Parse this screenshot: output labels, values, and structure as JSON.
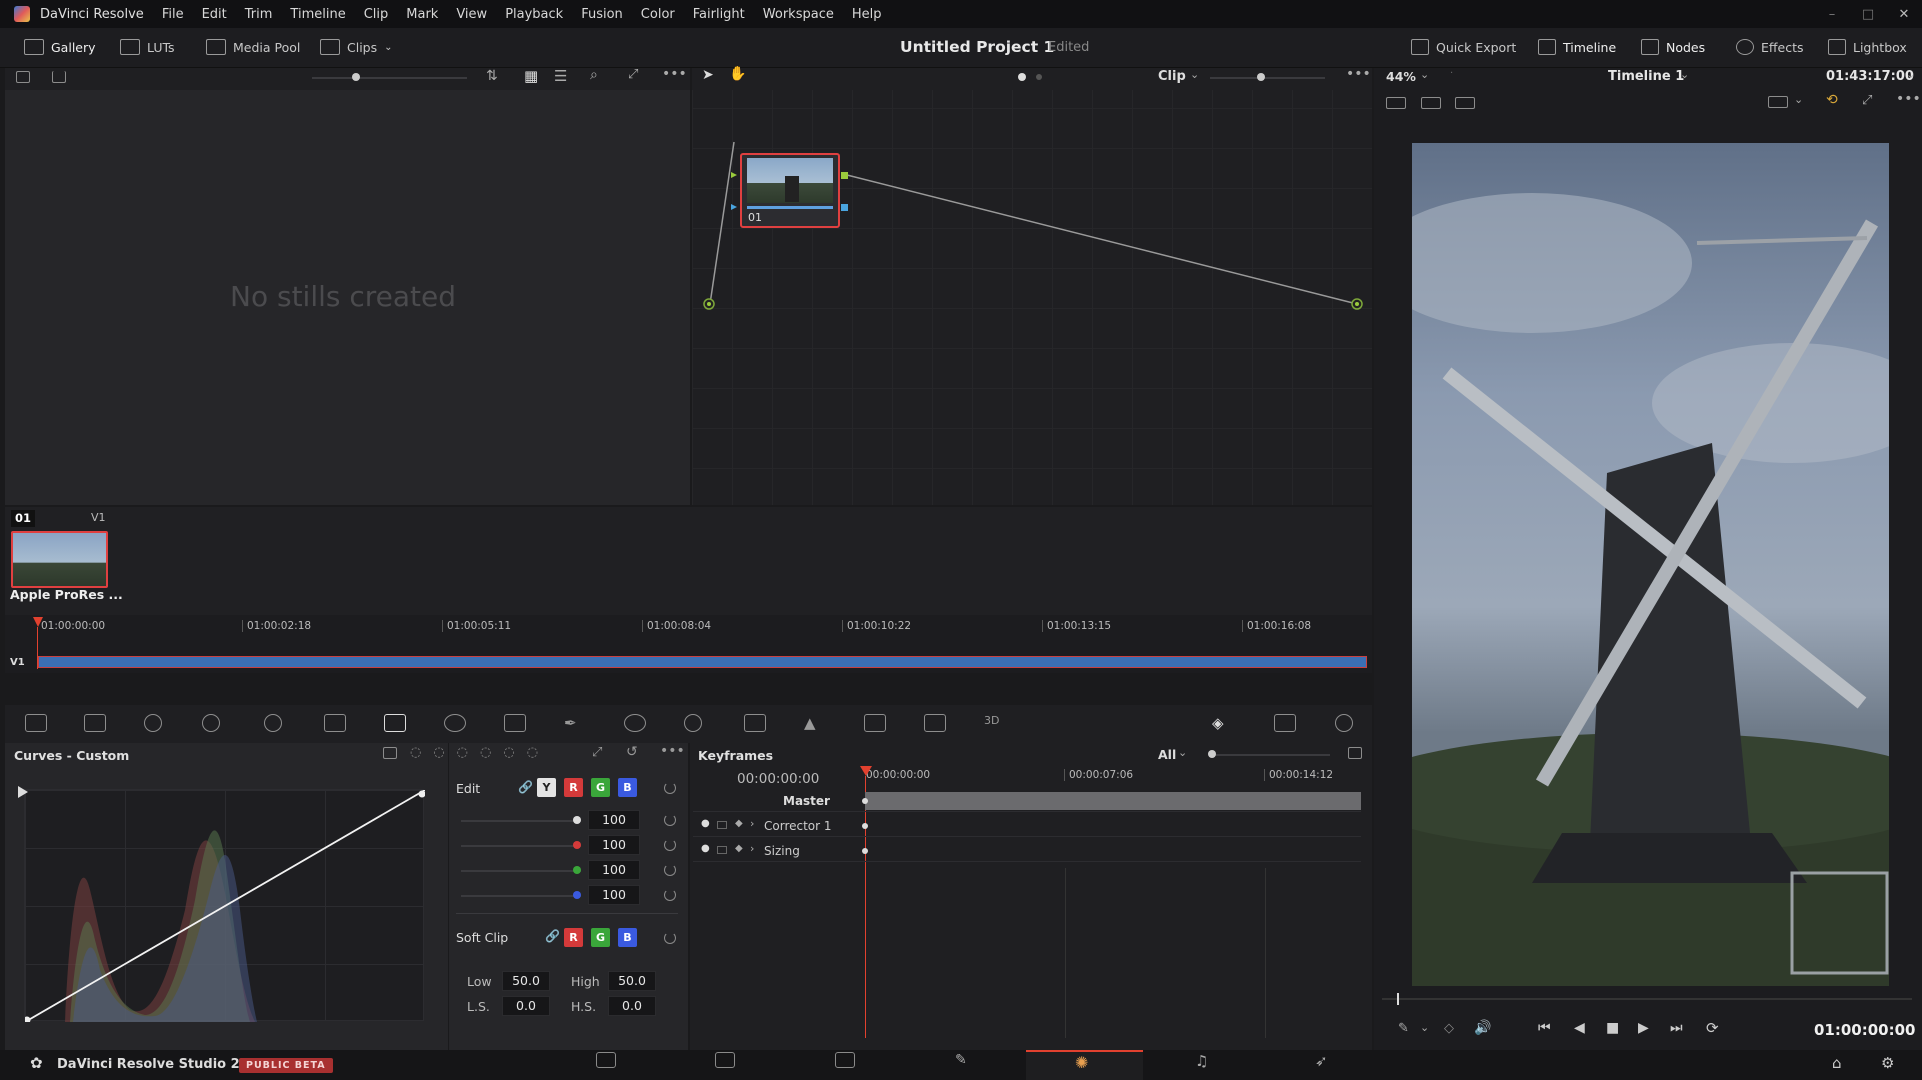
{
  "menubar": {
    "app": "DaVinci Resolve",
    "items": [
      "File",
      "Edit",
      "Trim",
      "Timeline",
      "Clip",
      "Mark",
      "View",
      "Playback",
      "Fusion",
      "Color",
      "Fairlight",
      "Workspace",
      "Help"
    ]
  },
  "toolbar": {
    "gallery": "Gallery",
    "luts": "LUTs",
    "media_pool": "Media Pool",
    "clips": "Clips",
    "project": "Untitled Project 1",
    "status": "Edited",
    "quick_export": "Quick Export",
    "timeline": "Timeline",
    "nodes": "Nodes",
    "effects": "Effects",
    "lightbox": "Lightbox"
  },
  "gallery": {
    "empty": "No stills created"
  },
  "node_editor": {
    "mode": "Clip",
    "node_label": "01"
  },
  "viewer": {
    "zoom": "44%",
    "timeline_name": "Timeline 1",
    "duration": "01:43:17:00",
    "timecode": "01:00:00:00"
  },
  "clip_strip": {
    "clip_number": "01",
    "track": "V1",
    "clip_name": "Apple ProRes ..."
  },
  "mini_timeline": {
    "track": "V1",
    "ticks": [
      "01:00:00:00",
      "01:00:02:18",
      "01:00:05:11",
      "01:00:08:04",
      "01:00:10:22",
      "01:00:13:15",
      "01:00:16:08"
    ]
  },
  "curves": {
    "title": "Curves - Custom",
    "edit_label": "Edit",
    "values": [
      "100",
      "100",
      "100",
      "100"
    ],
    "soft_clip": "Soft Clip",
    "low_label": "Low",
    "low": "50.0",
    "high_label": "High",
    "high": "50.0",
    "ls_label": "L.S.",
    "ls": "0.0",
    "hs_label": "H.S.",
    "hs": "0.0",
    "y": "Y",
    "r": "R",
    "g": "G",
    "b": "B"
  },
  "keyframes": {
    "title": "Keyframes",
    "filter": "All",
    "timecode": "00:00:00:00",
    "ticks": [
      "00:00:00:00",
      "00:00:07:06",
      "00:00:14:12"
    ],
    "tracks": [
      "Master",
      "Corrector 1",
      "Sizing"
    ]
  },
  "footer": {
    "product": "DaVinci Resolve Studio 20",
    "badge": "PUBLIC BETA"
  },
  "colors": {
    "accent": "#e2412f",
    "node_border": "#e04040",
    "clip_bar": "#3b6fb4"
  }
}
